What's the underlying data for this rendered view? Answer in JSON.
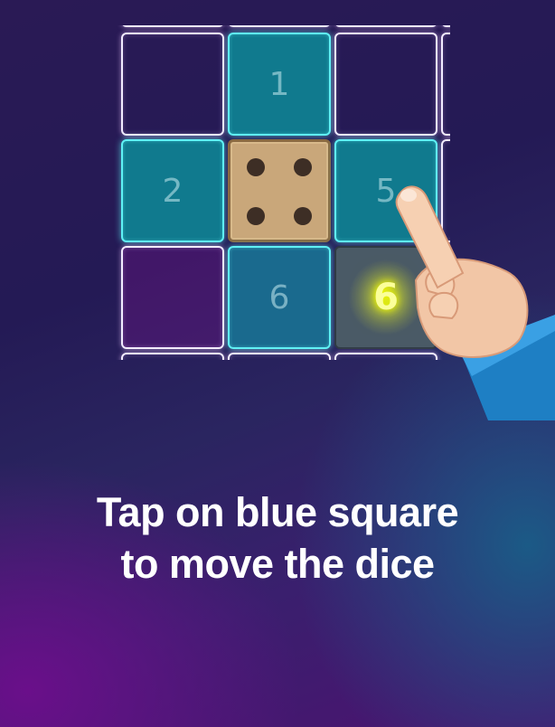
{
  "board": {
    "cells": [
      {
        "row": 0,
        "col": 0,
        "kind": "empty",
        "label": ""
      },
      {
        "row": 0,
        "col": 1,
        "kind": "blue",
        "label": "1"
      },
      {
        "row": 0,
        "col": 2,
        "kind": "empty",
        "label": ""
      },
      {
        "row": 1,
        "col": 0,
        "kind": "blue",
        "label": "2"
      },
      {
        "row": 1,
        "col": 1,
        "kind": "dice",
        "label": ""
      },
      {
        "row": 1,
        "col": 2,
        "kind": "blue",
        "label": "5"
      },
      {
        "row": 2,
        "col": 0,
        "kind": "empty",
        "label": ""
      },
      {
        "row": 2,
        "col": 1,
        "kind": "blue",
        "label": "6"
      },
      {
        "row": 2,
        "col": 2,
        "kind": "target",
        "label": "6"
      }
    ],
    "dice_face": 4
  },
  "caption": {
    "line1": "Tap on blue square",
    "line2": "to move the dice"
  },
  "colors": {
    "blue_cell": "#107a8e",
    "blue_border": "#5ff2f5",
    "neon_white": "#f2ecff",
    "glow_yellow": "#f6ff00",
    "dice": "#c9a77a"
  },
  "icons": {
    "pointer": "pointing-hand-icon"
  }
}
